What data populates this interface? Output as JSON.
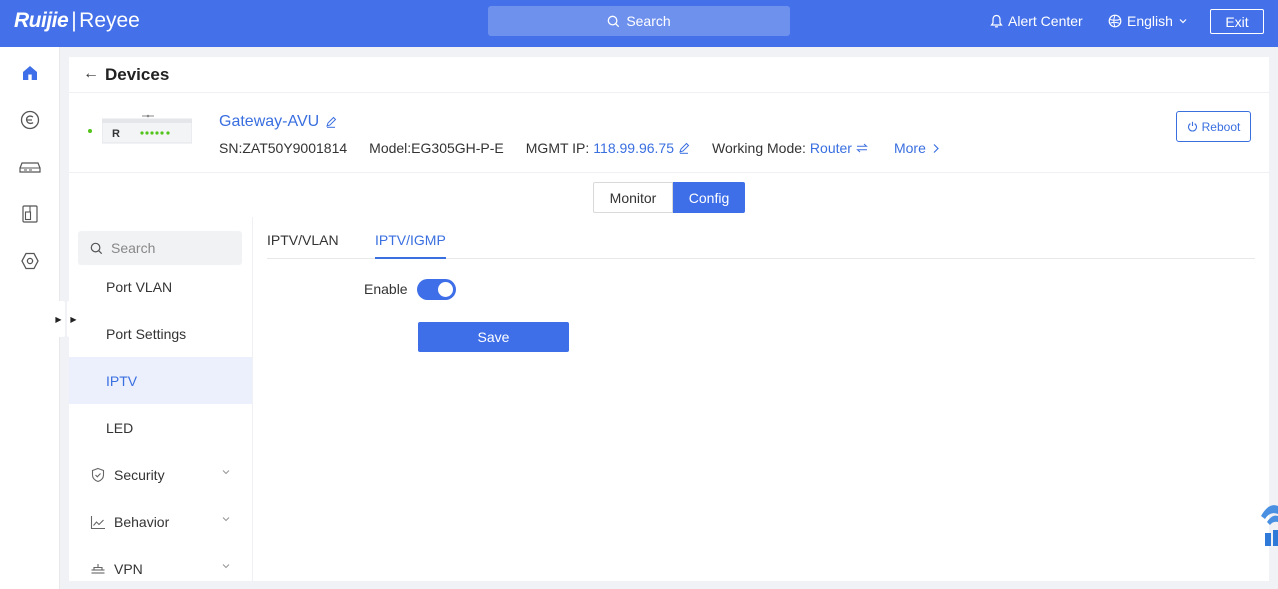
{
  "header": {
    "logo_brand": "Ruijie",
    "logo_sep": "|",
    "logo_product": "Reyee",
    "search_label": "Search",
    "alert_label": "Alert Center",
    "language_label": "English",
    "exit_label": "Exit"
  },
  "rail": {
    "icons": [
      "home-icon",
      "cloud-icon",
      "switch-icon",
      "ap-icon",
      "settings-icon"
    ]
  },
  "page": {
    "back_icon": "←",
    "title": "Devices"
  },
  "device": {
    "name": "Gateway-AVU",
    "sn_label": "SN:ZAT50Y9001814",
    "model_label": "Model:EG305GH-P-E",
    "mgmt_ip_prefix": "MGMT IP:",
    "mgmt_ip": "118.99.96.75",
    "mode_prefix": "Working Mode:",
    "mode_value": "Router",
    "more_label": "More",
    "reboot_label": "Reboot",
    "image_letter": "R"
  },
  "view_toggle": {
    "monitor_label": "Monitor",
    "config_label": "Config",
    "selected": "Config"
  },
  "sidebar": {
    "search_placeholder": "Search",
    "items": [
      {
        "label": "Port VLAN"
      },
      {
        "label": "Port Settings"
      },
      {
        "label": "IPTV"
      },
      {
        "label": "LED"
      }
    ],
    "groups": [
      {
        "label": "Security",
        "icon": "shield-icon"
      },
      {
        "label": "Behavior",
        "icon": "chart-icon"
      },
      {
        "label": "VPN",
        "icon": "vpn-icon"
      }
    ],
    "active": "IPTV"
  },
  "content": {
    "tabs": [
      {
        "label": "IPTV/VLAN"
      },
      {
        "label": "IPTV/IGMP"
      }
    ],
    "active_tab": "IPTV/IGMP",
    "enable_label": "Enable",
    "enable_on": true,
    "save_label": "Save"
  },
  "colors": {
    "primary": "#3e6ee8",
    "topbar": "#4470e9",
    "online": "#52c41a"
  }
}
